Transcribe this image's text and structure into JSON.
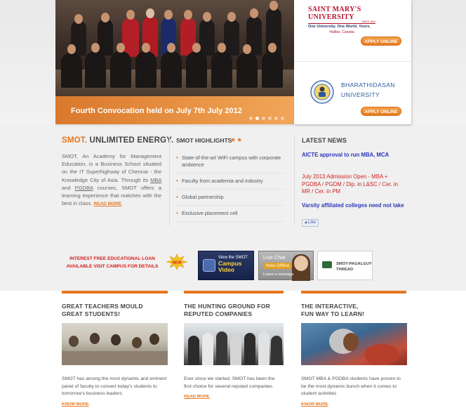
{
  "slider": {
    "caption": "Fourth Convocation held on July  7th July 2012",
    "dots": 6,
    "active_dot": 2
  },
  "partners": {
    "smu": {
      "name": "SAINT MARY'S UNIVERSITY",
      "since": "SINCE 1802",
      "tagline": "One University. One World. Yours.",
      "location": "Halifax, Canada",
      "apply_label": "APPLY ONLINE"
    },
    "bharathidasan": {
      "name_line1": "BHARATHIDASAN",
      "name_line2": "UNIVERSITY",
      "apply_label": "APPLY ONLINE"
    }
  },
  "about": {
    "heading_accent": "SMOT.",
    "heading_rest": " UNLIMITED ENERGY.",
    "text_1": "SMOT, An Academy for Management Education, is a Business School situated on the IT Superhighway of Chennai - the Knowledge City of Asia. Through its ",
    "mba": "MBA",
    "text_2": " and ",
    "pgdba": "PGDBA",
    "text_3": " courses, SMOT offers a learning experience that matches with the best in class. ",
    "read_more": "READ MORE"
  },
  "highlights": {
    "title": "SMOT HIGHLIGHTS",
    "stars": "★★",
    "items": [
      "State-of-the-art WiFi campus with corporate ambience",
      "Faculty from academia and industry",
      "Global partnership",
      "Exclusive placement cell"
    ]
  },
  "news": {
    "title": "LATEST NEWS",
    "items": [
      "AICTE approval to run MBA, MCA",
      "July 2013 Admission Open - MBA + PGDBA / PGDM / Dip. in L&SC / Cer. in MR / Cer. in PM",
      "Varsity affiliated colleges need not take"
    ],
    "like_label": "Like"
  },
  "banners": {
    "loan_line1": "INTEREST FREE EDUCATIONAL LOAN",
    "loan_line2": "AVAILABLE VISIT CAMPUS FOR DETAILS",
    "burst_label": "NEW",
    "campus_line1": "View the SMOT",
    "campus_line2": "Campus",
    "campus_line3": "Video",
    "chat_line1": "Live Chat",
    "chat_status": "Now Offline",
    "chat_line3": "Leave a message",
    "pagalguy_line1": "SMOT-PAGALGUY",
    "pagalguy_line2": "THREAD"
  },
  "columns": [
    {
      "title_line1": "GREAT TEACHERS MOULD",
      "title_line2": "GREAT STUDENTS!",
      "text": "SMOT has among the most dynamic and eminent panel of faculty to convert today's students to tomorrow's business leaders",
      "link": "KNOW MORE"
    },
    {
      "title_line1": "THE HUNTING GROUND FOR",
      "title_line2": "REPUTED COMPANIES",
      "text": "Ever since we started, SMOT has been the first choice for several reputed companies.",
      "link": "READ MORE"
    },
    {
      "title_line1": "THE INTERACTIVE,",
      "title_line2": "FUN WAY TO LEARN!",
      "text": "SMOT MBA & PGDBA students have proven to be the most dynamic bunch when it comes to student activities",
      "link": "KNOW MORE"
    }
  ]
}
